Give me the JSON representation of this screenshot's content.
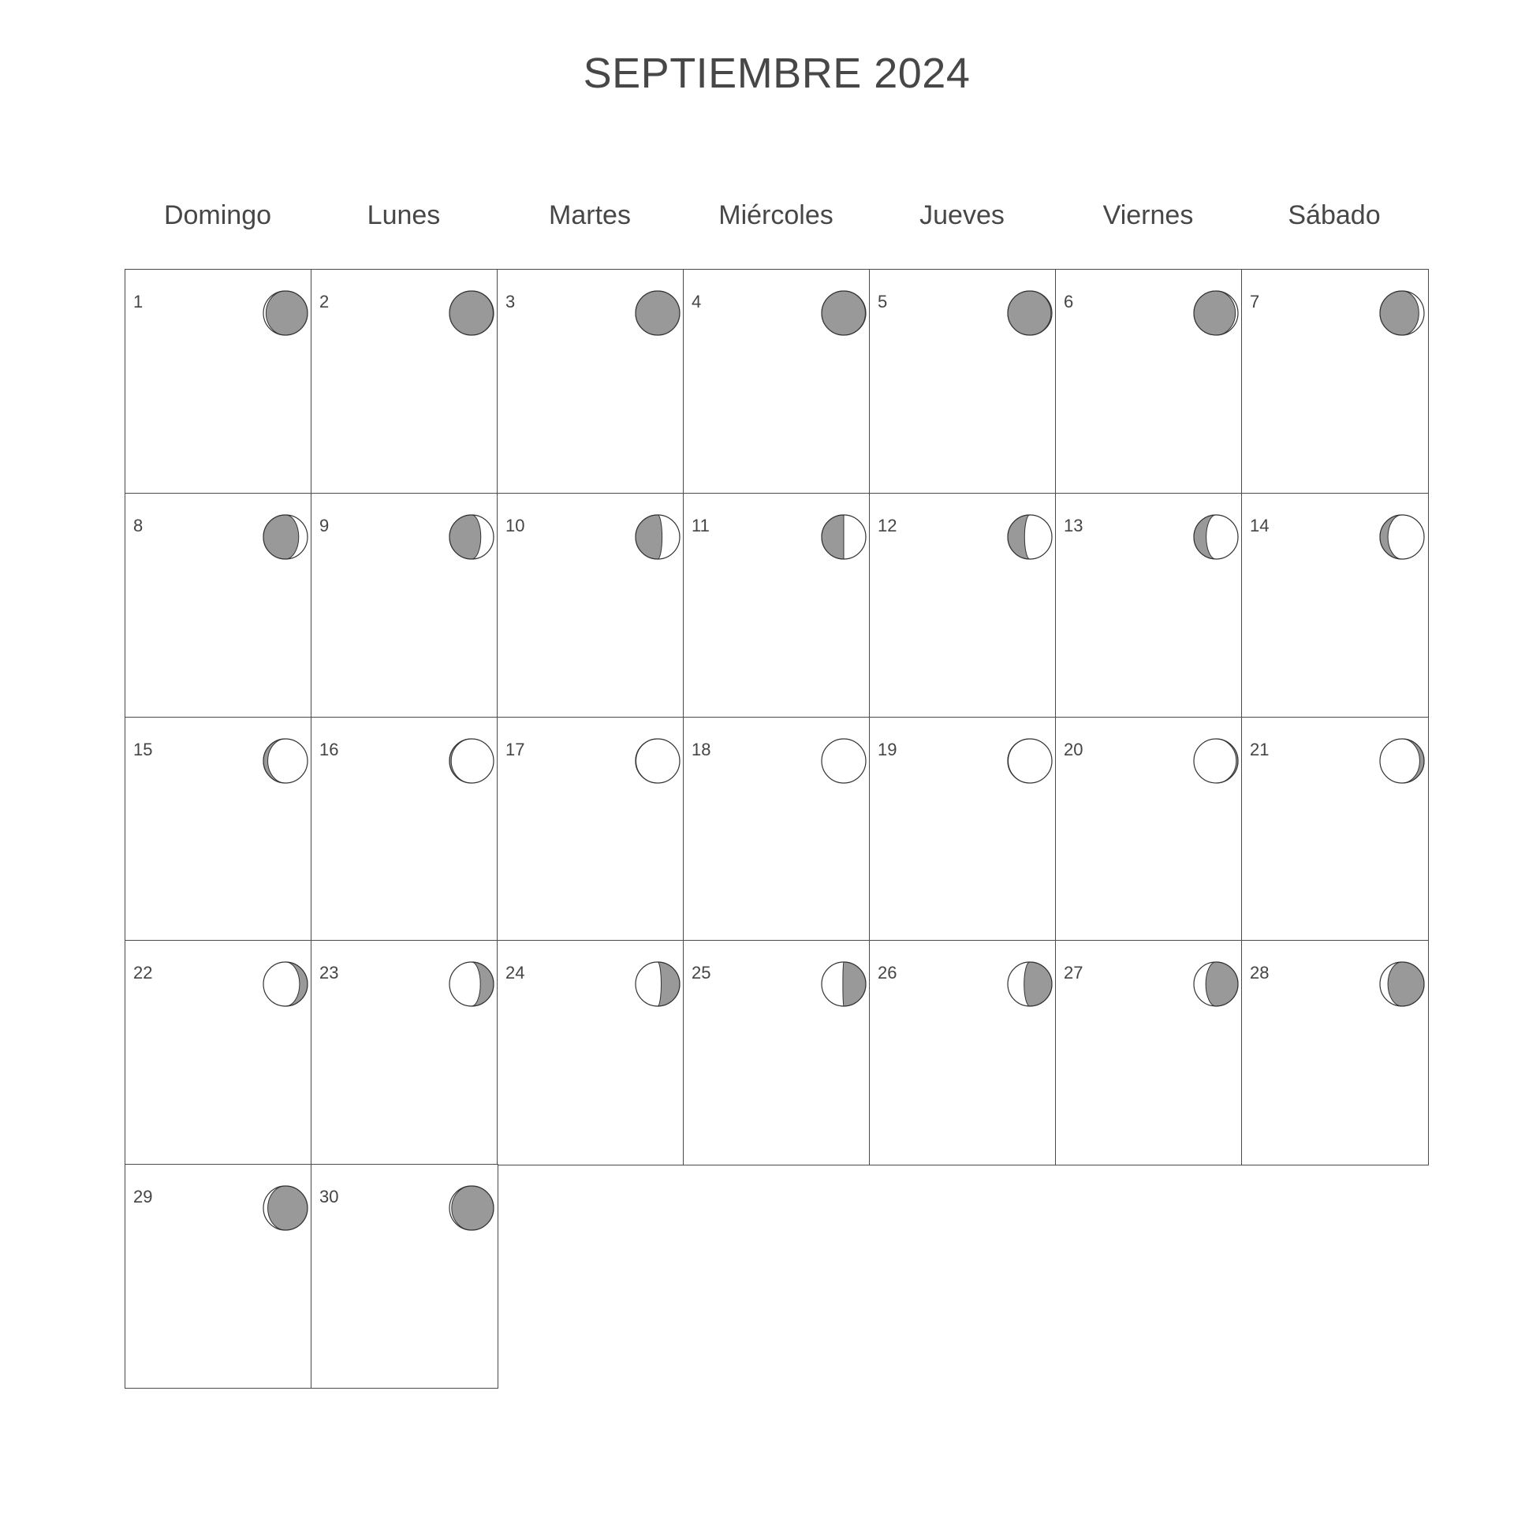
{
  "calendar": {
    "title": "SEPTIEMBRE 2024",
    "weekdays": [
      "Domingo",
      "Lunes",
      "Martes",
      "Miércoles",
      "Jueves",
      "Viernes",
      "Sábado"
    ],
    "first_weekday_index": 0,
    "days": [
      {
        "day": "1",
        "moon_phase": "waning-crescent",
        "illumination": 0.06
      },
      {
        "day": "2",
        "moon_phase": "new-moon",
        "illumination": 0.01
      },
      {
        "day": "3",
        "moon_phase": "new-moon",
        "illumination": 0.0
      },
      {
        "day": "4",
        "moon_phase": "new-moon",
        "illumination": 0.01
      },
      {
        "day": "5",
        "moon_phase": "waxing-crescent",
        "illumination": 0.02
      },
      {
        "day": "6",
        "moon_phase": "waxing-crescent",
        "illumination": 0.06
      },
      {
        "day": "7",
        "moon_phase": "waxing-crescent",
        "illumination": 0.12
      },
      {
        "day": "8",
        "moon_phase": "waxing-crescent",
        "illumination": 0.2
      },
      {
        "day": "9",
        "moon_phase": "waxing-crescent",
        "illumination": 0.29
      },
      {
        "day": "10",
        "moon_phase": "waxing-crescent",
        "illumination": 0.4
      },
      {
        "day": "11",
        "moon_phase": "first-quarter",
        "illumination": 0.5
      },
      {
        "day": "12",
        "moon_phase": "waxing-gibbous",
        "illumination": 0.62
      },
      {
        "day": "13",
        "moon_phase": "waxing-gibbous",
        "illumination": 0.72
      },
      {
        "day": "14",
        "moon_phase": "waxing-gibbous",
        "illumination": 0.82
      },
      {
        "day": "15",
        "moon_phase": "waxing-gibbous",
        "illumination": 0.9
      },
      {
        "day": "16",
        "moon_phase": "waxing-gibbous",
        "illumination": 0.96
      },
      {
        "day": "17",
        "moon_phase": "full-moon",
        "illumination": 0.99
      },
      {
        "day": "18",
        "moon_phase": "full-moon",
        "illumination": 1.0
      },
      {
        "day": "19",
        "moon_phase": "full-moon",
        "illumination": 0.99
      },
      {
        "day": "20",
        "moon_phase": "waning-gibbous",
        "illumination": 0.96
      },
      {
        "day": "21",
        "moon_phase": "waning-gibbous",
        "illumination": 0.9
      },
      {
        "day": "22",
        "moon_phase": "waning-gibbous",
        "illumination": 0.82
      },
      {
        "day": "23",
        "moon_phase": "waning-gibbous",
        "illumination": 0.7
      },
      {
        "day": "24",
        "moon_phase": "waning-gibbous",
        "illumination": 0.58
      },
      {
        "day": "25",
        "moon_phase": "last-quarter",
        "illumination": 0.48
      },
      {
        "day": "26",
        "moon_phase": "waning-crescent",
        "illumination": 0.37
      },
      {
        "day": "27",
        "moon_phase": "waning-crescent",
        "illumination": 0.27
      },
      {
        "day": "28",
        "moon_phase": "waning-crescent",
        "illumination": 0.18
      },
      {
        "day": "29",
        "moon_phase": "waning-crescent",
        "illumination": 0.1
      },
      {
        "day": "30",
        "moon_phase": "waning-crescent",
        "illumination": 0.05
      }
    ],
    "colors": {
      "shadow": "#999999",
      "outline": "#333333",
      "grid_line": "#4a4a4a",
      "text": "#444444"
    }
  }
}
